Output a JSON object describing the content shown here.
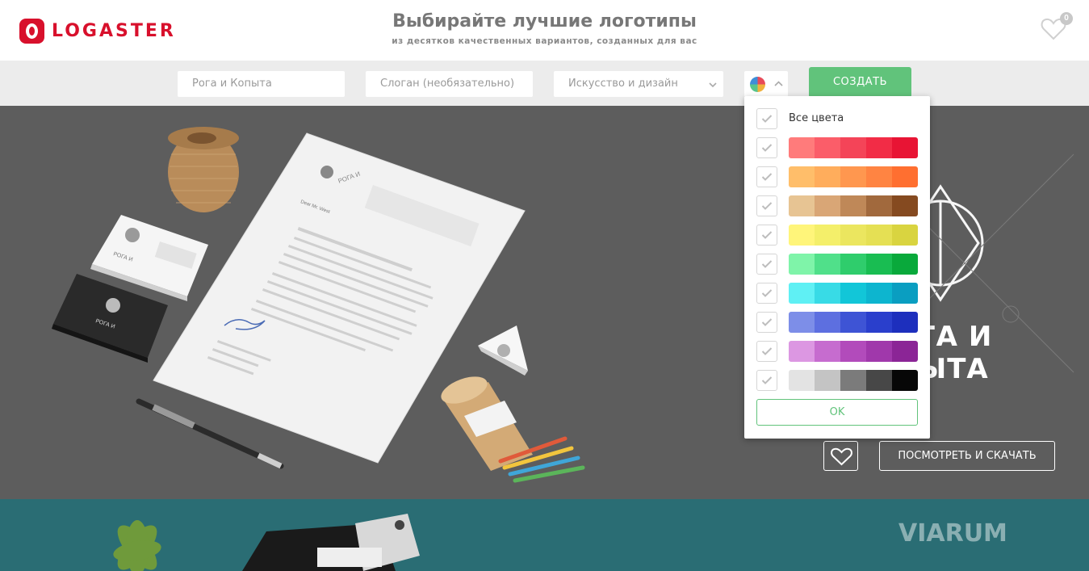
{
  "header": {
    "logo_text": "LOGASTER",
    "title": "Выбирайте лучшие логотипы",
    "subtitle": "из десятков качественных вариантов, созданных для вас",
    "favorites_count": "0"
  },
  "search": {
    "name_placeholder": "Рога и Копыта",
    "slogan_placeholder": "Слоган (необязательно)",
    "category_value": "Искусство и дизайн",
    "create_label": "СОЗДАТЬ"
  },
  "color_filter": {
    "all_label": "Все цвета",
    "ok_label": "OK",
    "palettes": [
      {
        "name": "red",
        "colors": [
          "#ff7b7b",
          "#fb5d69",
          "#f44458",
          "#f22c46",
          "#e81434"
        ]
      },
      {
        "name": "orange",
        "colors": [
          "#ffbe6a",
          "#ffad5c",
          "#ff974f",
          "#ff8442",
          "#ff6f30"
        ]
      },
      {
        "name": "brown",
        "colors": [
          "#e7c493",
          "#d9a676",
          "#bf8858",
          "#a1693d",
          "#854a20"
        ]
      },
      {
        "name": "yellow",
        "colors": [
          "#fff57a",
          "#f4ef6a",
          "#ebe65f",
          "#e5e054",
          "#d9d440"
        ]
      },
      {
        "name": "green",
        "colors": [
          "#7ff4a9",
          "#50e08a",
          "#2fcd6c",
          "#19bd52",
          "#09a93b"
        ]
      },
      {
        "name": "cyan",
        "colors": [
          "#5ff0f4",
          "#38dbe6",
          "#12c6d8",
          "#0db5cf",
          "#0a9ec1"
        ]
      },
      {
        "name": "blue",
        "colors": [
          "#7d8ee8",
          "#5d6fe0",
          "#3e54d5",
          "#2a3fcc",
          "#1d2fbd"
        ]
      },
      {
        "name": "purple",
        "colors": [
          "#dc97e2",
          "#c66ccf",
          "#b24bbb",
          "#a038ab",
          "#8b2596"
        ]
      },
      {
        "name": "gray",
        "colors": [
          "#e3e3e3",
          "#c4c4c4",
          "#7b7b7b",
          "#474747",
          "#070707"
        ]
      }
    ]
  },
  "preview": {
    "logo_line1": "ГА И",
    "logo_line2": "ЫТА",
    "view_download_label": "ПОСМОТРЕТЬ И СКАЧАТЬ"
  },
  "mockup": {
    "brand_line1": "РОГА И",
    "brand_line2": "КОПЫТА",
    "letter_greeting": "Dear Mr. West",
    "signature_name": "Сергей Иванов"
  },
  "watermark": "VIARUM"
}
